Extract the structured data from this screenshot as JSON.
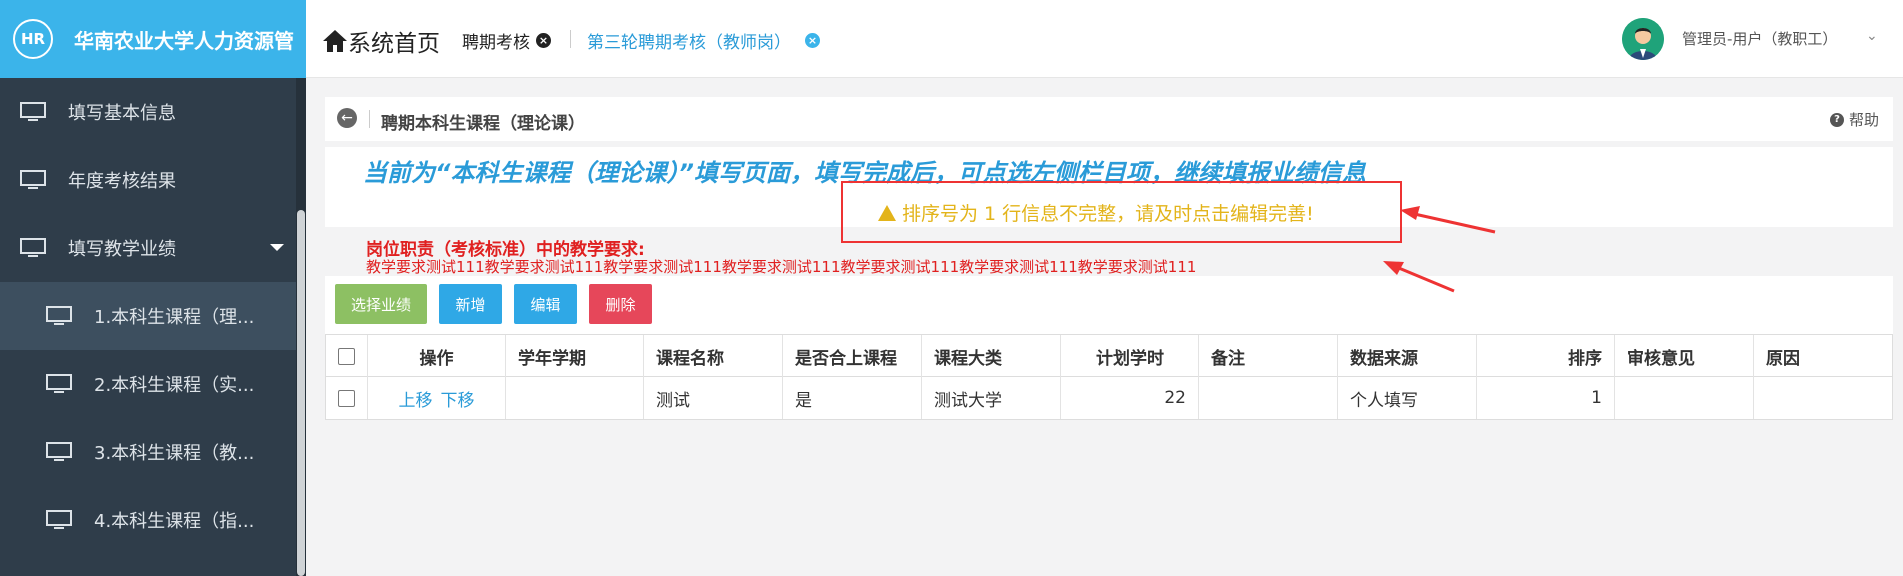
{
  "brand": {
    "logo": "HR",
    "title": "华南农业大学人力资源管"
  },
  "sidebar": {
    "items": [
      {
        "label": "填写基本信息",
        "icon": "monitor-icon"
      },
      {
        "label": "年度考核结果",
        "icon": "monitor-icon"
      },
      {
        "label": "填写教学业绩",
        "icon": "monitor-icon",
        "expanded": true
      },
      {
        "label": "1.本科生课程（理...",
        "icon": "monitor-icon",
        "active": true
      },
      {
        "label": "2.本科生课程（实...",
        "icon": "monitor-icon"
      },
      {
        "label": "3.本科生课程（教...",
        "icon": "monitor-icon"
      },
      {
        "label": "4.本科生课程（指...",
        "icon": "monitor-icon"
      }
    ]
  },
  "header": {
    "home_label": "系统首页",
    "tabs": [
      {
        "label": "聘期考核",
        "color": "#222222"
      },
      {
        "label": "第三轮聘期考核（教师岗）",
        "color": "#2a9bd8"
      }
    ],
    "user": "管理员-用户（教职工）"
  },
  "page": {
    "title": "聘期本科生课程（理论课）",
    "help": "帮助",
    "notice": "当前为“本科生课程（理论课）”填写页面，填写完成后，可点选左侧栏目项，继续填报业绩信息",
    "warning": "排序号为 1 行信息不完整，请及时点击编辑完善!",
    "req_title": "岗位职责（考核标准）中的教学要求:",
    "req_body": "教学要求测试111教学要求测试111教学要求测试111教学要求测试111教学要求测试111教学要求测试111教学要求测试111"
  },
  "toolbar": {
    "select_label": "选择业绩",
    "add_label": "新增",
    "edit_label": "编辑",
    "delete_label": "删除"
  },
  "table": {
    "columns": [
      "",
      "操作",
      "学年学期",
      "课程名称",
      "是否合上课程",
      "课程大类",
      "计划学时",
      "备注",
      "数据来源",
      "排序",
      "审核意见",
      "原因"
    ],
    "rows": [
      {
        "op_up": "上移",
        "op_down": "下移",
        "term": "",
        "course": "测试",
        "combined": "是",
        "category": "测试大学",
        "hours": "22",
        "remark": "",
        "source": "个人填写",
        "order": "1",
        "review": "",
        "reason": ""
      }
    ]
  },
  "colors": {
    "brand": "#3bb4ea",
    "sidebar": "#2f3d4a",
    "link": "#2a9bd8",
    "warning": "#e3b41a",
    "danger": "#e02020"
  }
}
